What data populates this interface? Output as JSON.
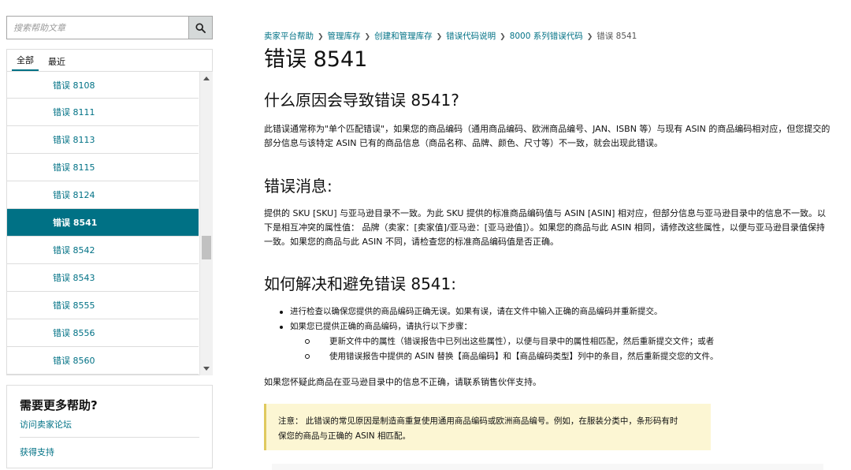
{
  "search": {
    "placeholder": "搜索帮助文章"
  },
  "nav": {
    "tabs": [
      {
        "label": "全部",
        "active": true
      },
      {
        "label": "最近",
        "active": false
      }
    ],
    "items": [
      {
        "label": "错误 8108"
      },
      {
        "label": "错误 8111"
      },
      {
        "label": "错误 8113"
      },
      {
        "label": "错误 8115"
      },
      {
        "label": "错误 8124"
      },
      {
        "label": "错误 8541",
        "active": true
      },
      {
        "label": "错误 8542"
      },
      {
        "label": "错误 8543"
      },
      {
        "label": "错误 8555"
      },
      {
        "label": "错误 8556"
      },
      {
        "label": "错误 8560"
      }
    ]
  },
  "help": {
    "title": "需要更多帮助?",
    "forum_link": "访问卖家论坛",
    "support_link": "获得支持"
  },
  "breadcrumb": [
    "卖家平台帮助",
    "管理库存",
    "创建和管理库存",
    "错误代码说明",
    "8000 系列错误代码",
    "错误 8541"
  ],
  "article": {
    "title": "错误 8541",
    "cause_heading": "什么原因会导致错误 8541?",
    "cause_text": "此错误通常称为\"单个匹配错误\"，如果您的商品编码（通用商品编码、欧洲商品编号、JAN、ISBN 等）与现有 ASIN 的商品编码相对应，但您提交的部分信息与该特定 ASIN 已有的商品信息（商品名称、品牌、颜色、尺寸等）不一致，就会出现此错误。",
    "message_heading": "错误消息:",
    "message_text": "提供的 SKU [SKU] 与亚马逊目录不一致。为此 SKU 提供的标准商品编码值与 ASIN [ASIN] 相对应，但部分信息与亚马逊目录中的信息不一致。以下是相互冲突的属性值： 品牌（卖家：[卖家值]/亚马逊：[亚马逊值]）。如果您的商品与此 ASIN 相同，请修改这些属性，以便与亚马逊目录值保持一致。如果您的商品与此 ASIN 不同，请检查您的标准商品编码值是否正确。",
    "resolve_heading": "如何解决和避免错误 8541:",
    "bullet1": "进行检查以确保您提供的商品编码正确无误。如果有误，请在文件中输入正确的商品编码并重新提交。",
    "bullet2": "如果您已提供正确的商品编码，请执行以下步骤：",
    "sub1": "更新文件中的属性（错误报告中已列出这些属性），以便与目录中的属性相匹配，然后重新提交文件；或者",
    "sub2": "使用错误报告中提供的 ASIN 替换【商品编码】和【商品编码类型】列中的条目，然后重新提交您的文件。",
    "closing": "如果您怀疑此商品在亚马逊目录中的信息不正确，请联系销售伙伴支持。",
    "note_line1": "注意： 此错误的常见原因是制造商重复使用通用商品编码或欧洲商品编号。例如，在服装分类中，条形码有时",
    "note_line2": "保您的商品与正确的 ASIN 相匹配。"
  },
  "colors": {
    "accent": "#007185",
    "note_bg": "#fcf6d3",
    "note_border": "#e0c95e"
  }
}
